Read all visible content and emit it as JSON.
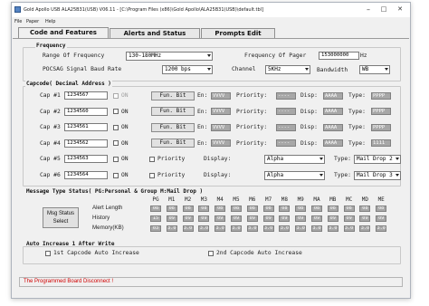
{
  "window": {
    "title": "Gold Apollo USB ALA25B31(USB)  V06.11 - [C:\\Program Files (x86)\\Gold Apollo\\ALA25B31(USB)\\default.tbl]",
    "menu": [
      "File",
      "Paper",
      "Help"
    ],
    "controls": {
      "minimize": "–",
      "maximize": "□",
      "close": "✕"
    }
  },
  "tabs": [
    "Code and Features",
    "Alerts and Status",
    "Prompts Edit"
  ],
  "frequency": {
    "title": "Frequency",
    "range_label": "Range Of Frequency",
    "range_value": "130-180MHz",
    "pager_label": "Frequency Of Pager",
    "pager_value": "153000000",
    "pager_unit": "Hz",
    "baud_label": "POCSAG Signal Baud Rate",
    "baud_value": "1200 bps",
    "channel_label": "Channel",
    "channel_value": "5KHz",
    "bandwidth_label": "Bandwidth",
    "bandwidth_value": "WB"
  },
  "capcode": {
    "title": "Capcode( Decimal Address )",
    "on_label": "ON",
    "funbit_label": "Fun. Bit",
    "en_label": "En:",
    "priority_label": "Priority:",
    "disp_label": "Disp:",
    "type_label": "Type:",
    "priority_chk_label": "Priority",
    "display_label": "Display:",
    "rows": [
      {
        "label": "Cap #1",
        "value": "1234567",
        "en": "VVVV",
        "priority": "----",
        "disp": "AAAA",
        "type": "PPPP"
      },
      {
        "label": "Cap #2",
        "value": "1234560",
        "en": "VVVV",
        "priority": "----",
        "disp": "AAAA",
        "type": "PPPP"
      },
      {
        "label": "Cap #3",
        "value": "1234561",
        "en": "VVVV",
        "priority": "----",
        "disp": "AAAA",
        "type": "PPPP"
      },
      {
        "label": "Cap #4",
        "value": "1234562",
        "en": "VVVV",
        "priority": "----",
        "disp": "AAAA",
        "type": "1111"
      },
      {
        "label": "Cap #5",
        "value": "1234563",
        "display": "Alpha",
        "type": "Mail Drop 2"
      },
      {
        "label": "Cap #6",
        "value": "1234564",
        "display": "Alpha",
        "type": "Mail Drop 3"
      }
    ]
  },
  "message": {
    "title": "Message Type Status( PG:Personal & Group    M:Mail Drop )",
    "button_label": "Msg Status Select",
    "columns": [
      "PG",
      "M1",
      "M2",
      "M3",
      "M4",
      "M5",
      "M6",
      "M7",
      "M8",
      "M9",
      "MA",
      "MB",
      "MC",
      "MD",
      "ME"
    ],
    "rows": [
      {
        "label": "Alert Length",
        "values": [
          "08",
          "08",
          "08",
          "08",
          "08",
          "08",
          "08",
          "08",
          "08",
          "08",
          "08",
          "08",
          "08",
          "08",
          "08"
        ]
      },
      {
        "label": "History",
        "values": [
          "15",
          "09",
          "09",
          "09",
          "09",
          "09",
          "09",
          "09",
          "09",
          "09",
          "09",
          "09",
          "09",
          "09",
          "09"
        ]
      },
      {
        "label": "Memory(KB)",
        "values": [
          "03",
          "3.0",
          "3.0",
          "3.0",
          "3.0",
          "3.0",
          "3.0",
          "3.0",
          "3.0",
          "3.0",
          "3.0",
          "3.0",
          "3.0",
          "3.0",
          "3.0"
        ]
      }
    ]
  },
  "auto_increase": {
    "title": "Auto Increase 1 After Write",
    "first_label": "1st Capcode Auto Increase",
    "second_label": "2nd Capcode Auto Increase"
  },
  "status_bar": {
    "text": "The Programmed Board Disconnect !"
  },
  "colors": {
    "status_text": "#d00000",
    "disabled_field": "#a7a7a7",
    "accent_icon": "#5584c3"
  }
}
